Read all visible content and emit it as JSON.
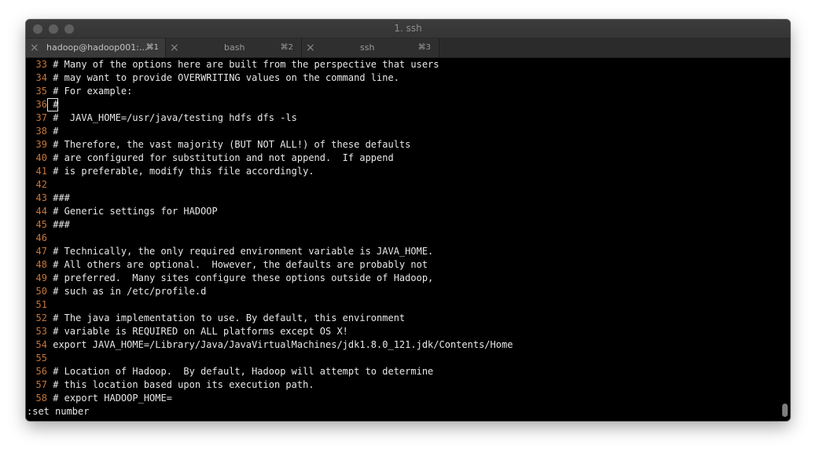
{
  "window": {
    "title": "1. ssh"
  },
  "tabs": [
    {
      "label": "hadoop@hadoop001:...",
      "shortcut": "⌘1",
      "active": true
    },
    {
      "label": "bash",
      "shortcut": "⌘2",
      "active": false
    },
    {
      "label": "ssh",
      "shortcut": "⌘3",
      "active": false
    }
  ],
  "editor": {
    "lines": [
      {
        "num": "33",
        "text": " # Many of the options here are built from the perspective that users"
      },
      {
        "num": "34",
        "text": " # may want to provide OVERWRITING values on the command line."
      },
      {
        "num": "35",
        "text": " # For example:"
      },
      {
        "num": "36",
        "text": " #"
      },
      {
        "num": "37",
        "text": " #  JAVA_HOME=/usr/java/testing hdfs dfs -ls"
      },
      {
        "num": "38",
        "text": " #"
      },
      {
        "num": "39",
        "text": " # Therefore, the vast majority (BUT NOT ALL!) of these defaults"
      },
      {
        "num": "40",
        "text": " # are configured for substitution and not append.  If append"
      },
      {
        "num": "41",
        "text": " # is preferable, modify this file accordingly."
      },
      {
        "num": "42",
        "text": ""
      },
      {
        "num": "43",
        "text": " ###"
      },
      {
        "num": "44",
        "text": " # Generic settings for HADOOP"
      },
      {
        "num": "45",
        "text": " ###"
      },
      {
        "num": "46",
        "text": ""
      },
      {
        "num": "47",
        "text": " # Technically, the only required environment variable is JAVA_HOME."
      },
      {
        "num": "48",
        "text": " # All others are optional.  However, the defaults are probably not"
      },
      {
        "num": "49",
        "text": " # preferred.  Many sites configure these options outside of Hadoop,"
      },
      {
        "num": "50",
        "text": " # such as in /etc/profile.d"
      },
      {
        "num": "51",
        "text": ""
      },
      {
        "num": "52",
        "text": " # The java implementation to use. By default, this environment"
      },
      {
        "num": "53",
        "text": " # variable is REQUIRED on ALL platforms except OS X!"
      },
      {
        "num": "54",
        "text": " export JAVA_HOME=/Library/Java/JavaVirtualMachines/jdk1.8.0_121.jdk/Contents/Home"
      },
      {
        "num": "55",
        "text": ""
      },
      {
        "num": "56",
        "text": " # Location of Hadoop.  By default, Hadoop will attempt to determine"
      },
      {
        "num": "57",
        "text": " # this location based upon its execution path."
      },
      {
        "num": "58",
        "text": " # export HADOOP_HOME="
      }
    ],
    "command_line": ":set number"
  },
  "colors": {
    "background": "#000000",
    "line_number": "#c5763a",
    "text": "#e8e8e8"
  }
}
